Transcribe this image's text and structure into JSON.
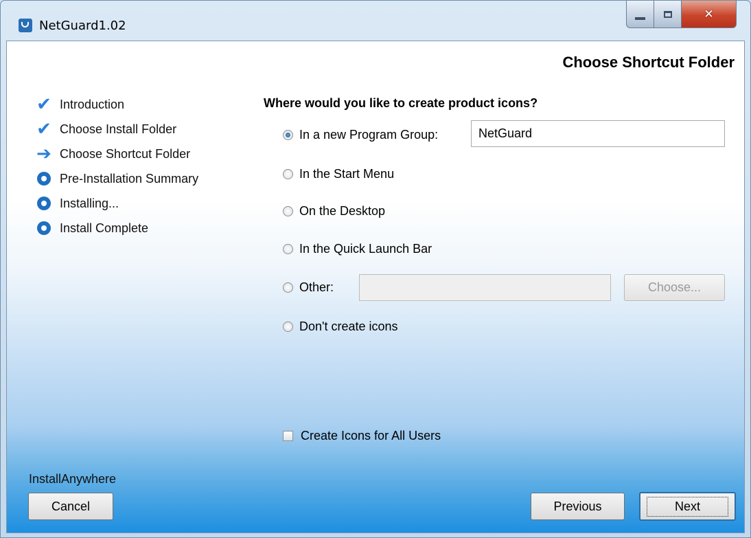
{
  "window": {
    "title": "NetGuard1.02",
    "controls": {
      "close": "✕"
    }
  },
  "page": {
    "heading": "Choose Shortcut Folder",
    "question": "Where would you like to create product icons?"
  },
  "steps": [
    {
      "label": "Introduction",
      "state": "done",
      "icon": "checkmark-icon"
    },
    {
      "label": "Choose Install Folder",
      "state": "done",
      "icon": "checkmark-icon"
    },
    {
      "label": "Choose Shortcut Folder",
      "state": "current",
      "icon": "arrow-right-icon"
    },
    {
      "label": "Pre-Installation Summary",
      "state": "pending",
      "icon": "circle-icon"
    },
    {
      "label": "Installing...",
      "state": "pending",
      "icon": "circle-icon"
    },
    {
      "label": "Install Complete",
      "state": "pending",
      "icon": "circle-icon"
    }
  ],
  "options": {
    "new_program_group": {
      "label": "In a new Program Group:",
      "checked": true,
      "value": "NetGuard"
    },
    "start_menu": {
      "label": "In the Start Menu",
      "checked": false
    },
    "desktop": {
      "label": "On the Desktop",
      "checked": false
    },
    "quick_launch": {
      "label": "In the Quick Launch Bar",
      "checked": false
    },
    "other": {
      "label": "Other:",
      "checked": false,
      "value": "",
      "choose_label": "Choose..."
    },
    "none": {
      "label": "Don't create icons",
      "checked": false
    }
  },
  "all_users": {
    "label": "Create Icons for All Users",
    "checked": false
  },
  "footer": {
    "brand": "InstallAnywhere",
    "cancel": "Cancel",
    "previous": "Previous",
    "next": "Next"
  },
  "colors": {
    "accent": "#2b7fd9",
    "pending": "#1f6fc0",
    "close_button": "#c9462c"
  }
}
